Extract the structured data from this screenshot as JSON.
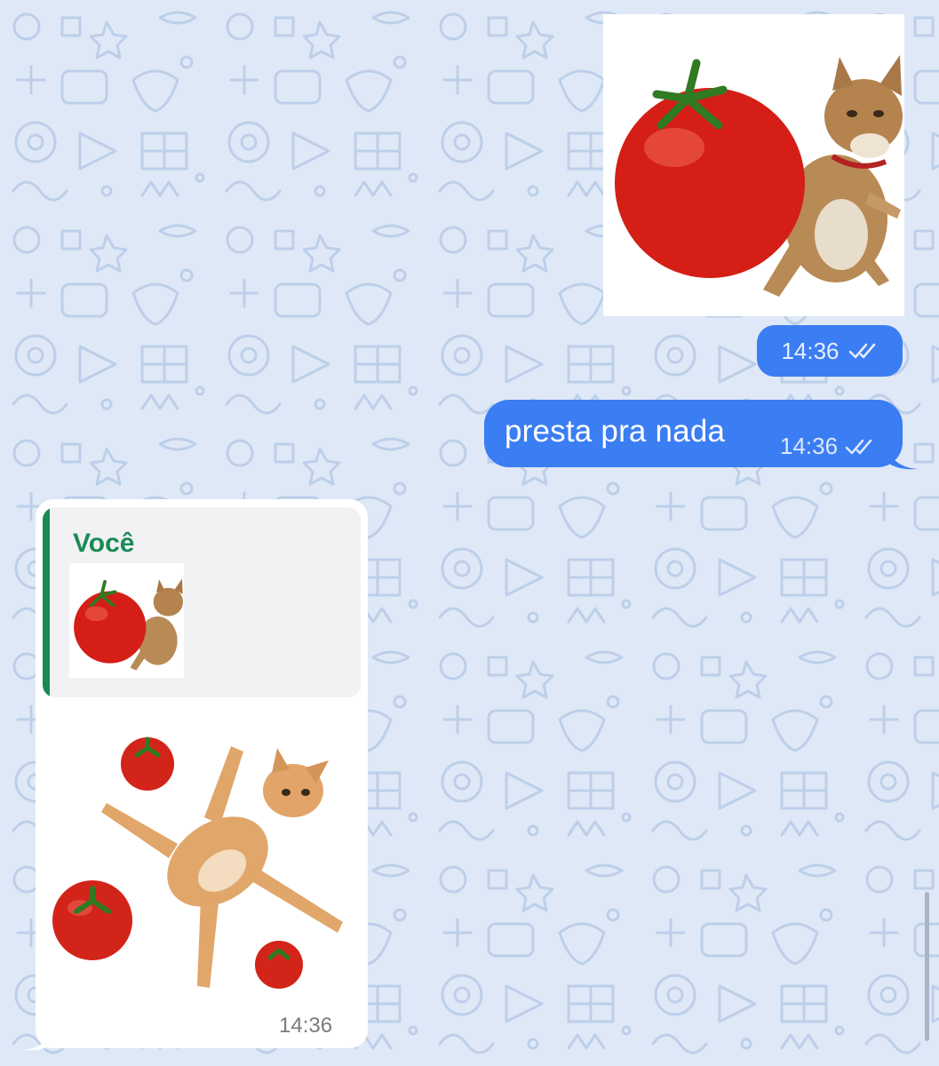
{
  "colors": {
    "background": "#dfe8f6",
    "pattern": "#b9cdea",
    "outgoing_bubble": "#3b7df2",
    "incoming_bubble": "#ffffff",
    "quote_accent": "#1a8a55"
  },
  "messages": [
    {
      "direction": "outgoing",
      "type": "sticker",
      "sticker_icon": "tomato-cat-sticker",
      "time": "14:36",
      "status_icon": "double-check-icon"
    },
    {
      "direction": "outgoing",
      "type": "text",
      "text": "presta pra nada",
      "time": "14:36",
      "status_icon": "double-check-icon"
    },
    {
      "direction": "incoming",
      "type": "sticker-reply",
      "quote": {
        "author": "Você",
        "thumbnail_icon": "tomato-cat-sticker"
      },
      "sticker_icon": "cat-with-tomatoes-sticker",
      "time": "14:36"
    }
  ]
}
